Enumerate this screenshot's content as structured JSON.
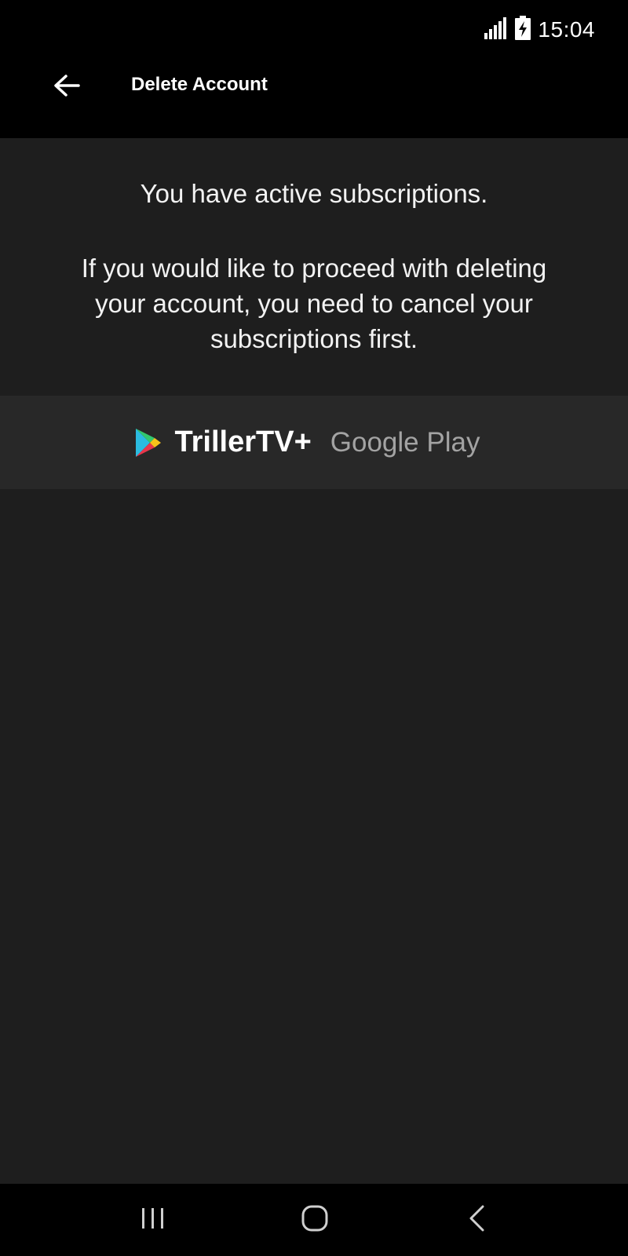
{
  "status_bar": {
    "time": "15:04",
    "icons": [
      "signal-icon",
      "battery-charging-icon"
    ]
  },
  "app_bar": {
    "title": "Delete Account",
    "back_icon": "arrow-left-icon"
  },
  "message": {
    "headline": "You have active subscriptions.",
    "body": "If you would like to proceed with deleting your account, you need to cancel your subscriptions first."
  },
  "subscriptions": [
    {
      "name": "TrillerTV+",
      "store": "Google Play",
      "icon": "google-play-icon"
    }
  ],
  "nav_bar": {
    "icons": [
      "recent-apps-icon",
      "home-icon",
      "back-icon"
    ]
  },
  "colors": {
    "background": "#1e1e1e",
    "bars": "#000000",
    "row": "#282828",
    "text": "#f2f2f2",
    "secondary_text": "#a3a3a3"
  }
}
